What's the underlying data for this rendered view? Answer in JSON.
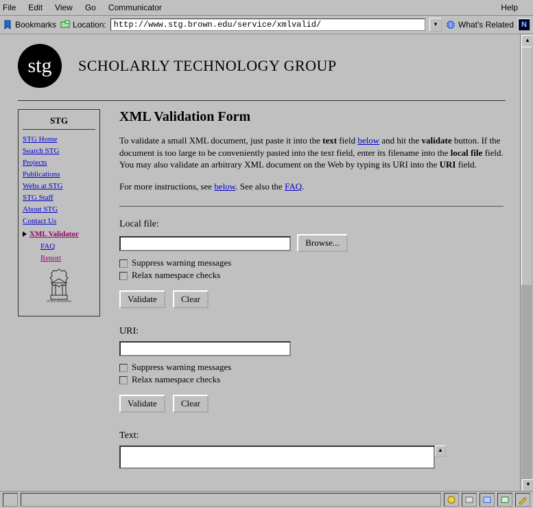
{
  "menubar": {
    "items": [
      "File",
      "Edit",
      "View",
      "Go",
      "Communicator"
    ],
    "help": "Help"
  },
  "toolbar": {
    "bookmarks_label": "Bookmarks",
    "location_label": "Location:",
    "location_value": "http://www.stg.brown.edu/service/xmlvalid/",
    "whats_related_label": "What's Related",
    "n_badge": "N"
  },
  "header": {
    "logo_text": "stg",
    "site_title": "SCHOLARLY TECHNOLOGY GROUP"
  },
  "sidebar": {
    "title": "STG",
    "links": [
      {
        "label": "STG Home"
      },
      {
        "label": "Search STG"
      },
      {
        "label": "Projects"
      },
      {
        "label": "Publications"
      },
      {
        "label": "Webs at STG"
      },
      {
        "label": "STG Staff"
      },
      {
        "label": "About STG"
      },
      {
        "label": "Contact Us"
      }
    ],
    "current": {
      "label": "XML Validator"
    },
    "sub": [
      {
        "label": "FAQ"
      },
      {
        "label": "Report"
      }
    ]
  },
  "main": {
    "h1": "XML Validation Form",
    "intro_pre": "To validate a small XML document, just paste it into the ",
    "intro_bold1": "text",
    "intro_mid1": " field ",
    "intro_link1": "below",
    "intro_mid2": " and hit the ",
    "intro_bold2": "validate",
    "intro_mid3": " button. If the document is too large to be conveniently pasted into the text field, enter its filename into the ",
    "intro_bold3": "local file",
    "intro_mid4": " field. You may also validate an arbitrary XML document on the Web by typing its URI into the ",
    "intro_bold4": "URI",
    "intro_post": " field.",
    "instr_pre": "For more instructions, see ",
    "instr_link1": "below",
    "instr_mid": ". See also the ",
    "instr_link2": "FAQ",
    "instr_post": ".",
    "local_file_label": "Local file:",
    "browse_label": "Browse...",
    "suppress_label": "Suppress warning messages",
    "relax_label": "Relax namespace checks",
    "validate_label": "Validate",
    "clear_label": "Clear",
    "uri_label": "URI:",
    "text_label": "Text:"
  }
}
